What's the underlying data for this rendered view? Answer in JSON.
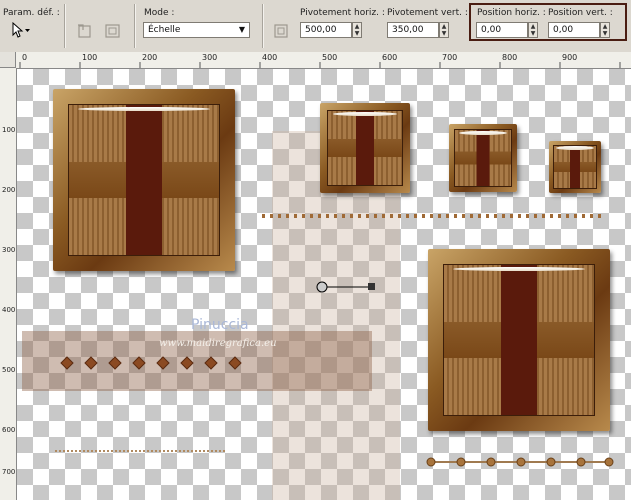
{
  "toolbar": {
    "preset_label": "Param. déf. :",
    "mode_label": "Mode :",
    "mode_value": "Échelle",
    "pivot_h_label": "Pivotement horiz. :",
    "pivot_h_value": "500,00",
    "pivot_v_label": "Pivotement vert. :",
    "pivot_v_value": "350,00",
    "pos_h_label": "Position horiz. :",
    "pos_h_value": "0,00",
    "pos_v_label": "Position vert. :",
    "pos_v_value": "0,00",
    "highlight_color": "#4a1d12"
  },
  "ruler": {
    "top_marks": [
      "0",
      "100",
      "200",
      "300",
      "400",
      "500",
      "600",
      "700",
      "800",
      "900"
    ],
    "left_marks": [
      "100",
      "200",
      "300",
      "400",
      "500",
      "600",
      "700"
    ]
  },
  "canvas": {
    "watermark_line1": "Pinuccia",
    "watermark_line2": "www.maidiregrafica.eu",
    "tile_color": "#8a5a22",
    "accent_color": "#5a1a0c"
  }
}
